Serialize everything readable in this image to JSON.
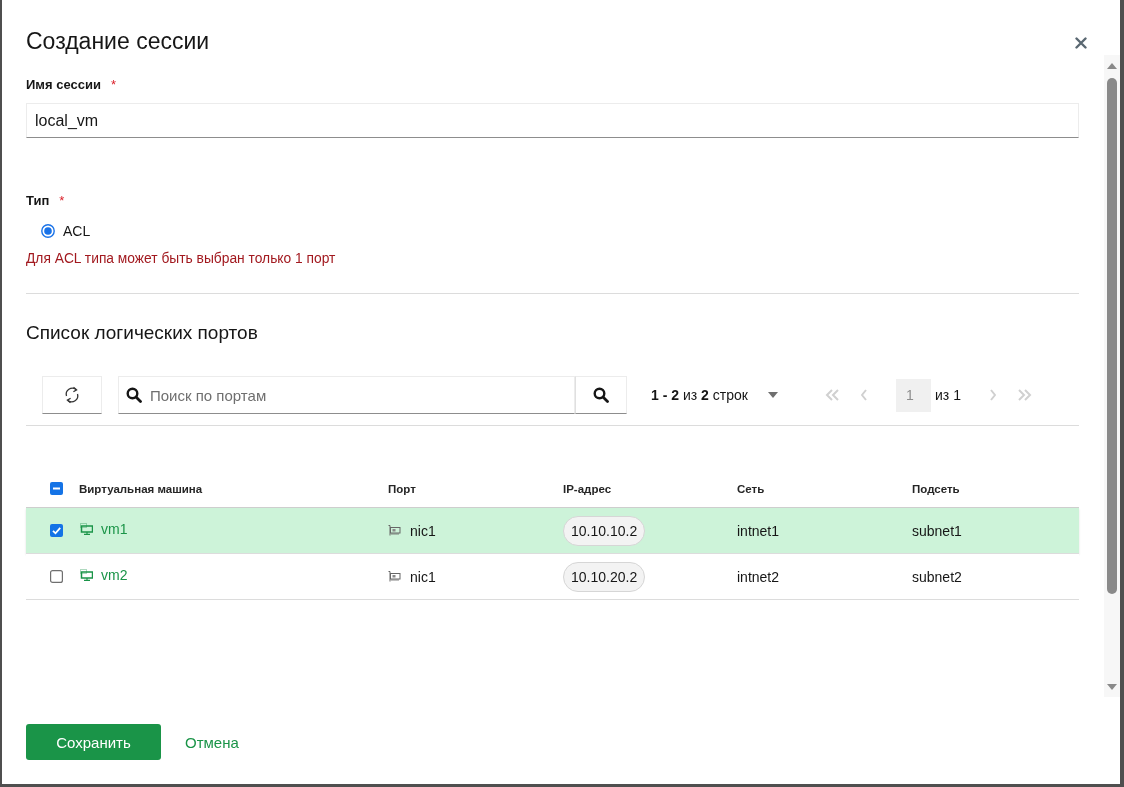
{
  "dialog": {
    "title": "Создание сессии"
  },
  "form": {
    "session_name": {
      "label": "Имя сессии",
      "required_mark": "*",
      "value": "local_vm"
    },
    "type": {
      "label": "Тип",
      "required_mark": "*",
      "options": [
        {
          "label": "ACL",
          "selected": true
        }
      ],
      "hint": "Для ACL типа может быть выбран только 1 порт"
    }
  },
  "ports": {
    "title": "Список логических портов",
    "search": {
      "placeholder": "Поиск по портам"
    },
    "row_count": "**1 - 2** из **2** строк",
    "pagination": {
      "page": "1",
      "total": "из 1",
      "nav": [
        {
          "kind": "first",
          "disabled": true
        },
        {
          "kind": "prev",
          "disabled": true
        },
        {
          "kind": "next",
          "disabled": true
        },
        {
          "kind": "last",
          "disabled": true
        }
      ]
    },
    "table": {
      "select_all": {
        "checked": false,
        "indeterminate": true
      },
      "columns": [
        "Виртуальная машина",
        "Порт",
        "IP-адрес",
        "Сеть",
        "Подсеть"
      ],
      "rows": [
        {
          "selected": true,
          "vm": "vm1",
          "port": "nic1",
          "ip": "10.10.10.2",
          "network": "intnet1",
          "subnet": "subnet1"
        },
        {
          "selected": false,
          "vm": "vm2",
          "port": "nic1",
          "ip": "10.10.20.2",
          "network": "intnet2",
          "subnet": "subnet2"
        }
      ]
    }
  },
  "buttons": [
    {
      "label": "Сохранить",
      "kind": "primary"
    },
    {
      "label": "Отмена",
      "kind": "link"
    }
  ]
}
